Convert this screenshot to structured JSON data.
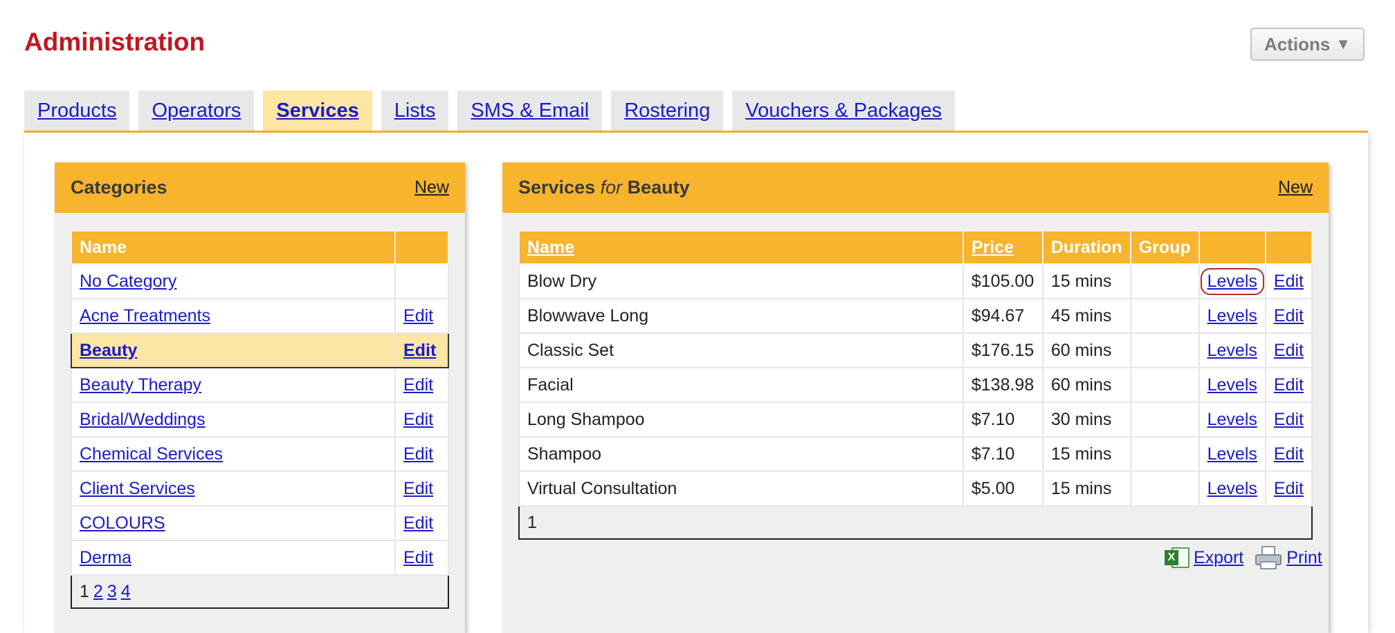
{
  "page": {
    "title": "Administration"
  },
  "actions": {
    "label": "Actions",
    "arrow": "▼"
  },
  "tabs": [
    {
      "label": "Products",
      "active": false
    },
    {
      "label": "Operators",
      "active": false
    },
    {
      "label": "Services",
      "active": true
    },
    {
      "label": "Lists",
      "active": false
    },
    {
      "label": "SMS & Email",
      "active": false
    },
    {
      "label": "Rostering",
      "active": false
    },
    {
      "label": "Vouchers & Packages",
      "active": false
    }
  ],
  "categories": {
    "title": "Categories",
    "new_label": "New",
    "col_name": "Name",
    "rows": [
      {
        "name": "No Category",
        "edit": ""
      },
      {
        "name": "Acne Treatments",
        "edit": "Edit"
      },
      {
        "name": "Beauty",
        "edit": "Edit",
        "selected": true
      },
      {
        "name": "Beauty Therapy",
        "edit": "Edit"
      },
      {
        "name": "Bridal/Weddings",
        "edit": "Edit"
      },
      {
        "name": "Chemical Services",
        "edit": "Edit"
      },
      {
        "name": "Client Services",
        "edit": "Edit"
      },
      {
        "name": "COLOURS",
        "edit": "Edit"
      },
      {
        "name": "Derma",
        "edit": "Edit"
      }
    ],
    "pager": {
      "current": "1",
      "pages": [
        "2",
        "3",
        "4"
      ]
    }
  },
  "services": {
    "title_prefix": "Services",
    "title_for": "for",
    "title_category": "Beauty",
    "new_label": "New",
    "columns": {
      "name": "Name",
      "price": "Price",
      "duration": "Duration",
      "group": "Group"
    },
    "rows": [
      {
        "name": "Blow Dry",
        "price": "$105.00",
        "duration": "15 mins",
        "group": "",
        "levels": "Levels",
        "edit": "Edit"
      },
      {
        "name": "Blowwave Long",
        "price": "$94.67",
        "duration": "45 mins",
        "group": "",
        "levels": "Levels",
        "edit": "Edit"
      },
      {
        "name": "Classic Set",
        "price": "$176.15",
        "duration": "60 mins",
        "group": "",
        "levels": "Levels",
        "edit": "Edit"
      },
      {
        "name": "Facial",
        "price": "$138.98",
        "duration": "60 mins",
        "group": "",
        "levels": "Levels",
        "edit": "Edit"
      },
      {
        "name": "Long Shampoo",
        "price": "$7.10",
        "duration": "30 mins",
        "group": "",
        "levels": "Levels",
        "edit": "Edit"
      },
      {
        "name": "Shampoo",
        "price": "$7.10",
        "duration": "15 mins",
        "group": "",
        "levels": "Levels",
        "edit": "Edit"
      },
      {
        "name": "Virtual Consultation",
        "price": "$5.00",
        "duration": "15 mins",
        "group": "",
        "levels": "Levels",
        "edit": "Edit"
      }
    ],
    "pager": {
      "current": "1"
    },
    "export_label": "Export",
    "print_label": "Print"
  },
  "colors": {
    "accent": "#f7b42c",
    "title_red": "#c0171e",
    "link": "#1a1acc",
    "selected_bg": "#fde6a4"
  },
  "icons": {
    "export": "excel-icon",
    "print": "printer-icon"
  }
}
